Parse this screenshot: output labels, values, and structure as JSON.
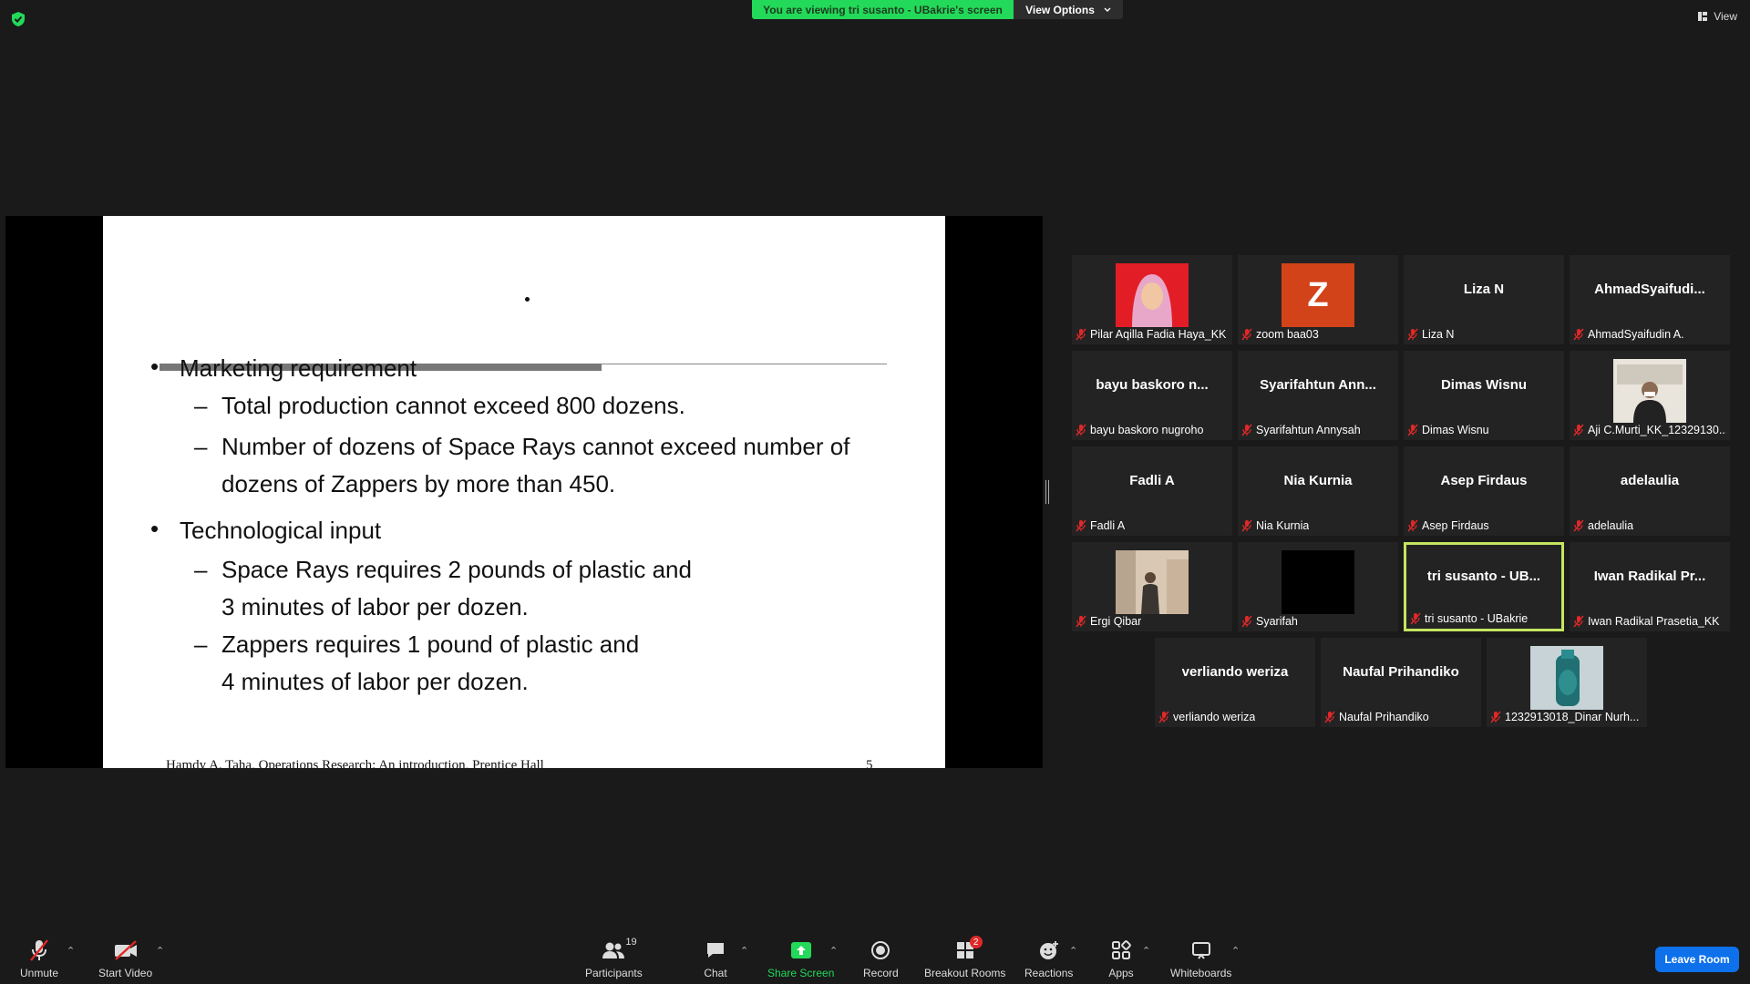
{
  "banner": {
    "viewing_text": "You are viewing tri susanto - UBakrie's screen",
    "view_options_label": "View Options"
  },
  "top_right": {
    "view_label": "View"
  },
  "slide": {
    "bullet1": "Marketing requirement",
    "sub1": "Total production cannot exceed 800 dozens.",
    "sub2_line1": "Number of dozens of Space Rays cannot exceed  number of",
    "sub2_line2": "dozens of Zappers by more than 450.",
    "bullet2": "Technological input",
    "sub3_line1": "Space Rays requires 2 pounds of plastic and",
    "sub3_line2": "3 minutes of labor per dozen.",
    "sub4_line1": " Zappers requires 1 pound of plastic and",
    "sub4_line2": "4 minutes of labor per dozen.",
    "footer_text": "Hamdy A. Taha, Operations Research: An introduction, Prentice Hall",
    "page_number": "5",
    "bullet_char": "•",
    "dash_char": "–"
  },
  "participants": [
    {
      "display": "",
      "label": "Pilar Aqilla Fadia Haya_KK",
      "avatar": "photo-hijab"
    },
    {
      "display": "Z",
      "label": "zoom baa03",
      "avatar": "letter"
    },
    {
      "display": "Liza N",
      "label": "Liza N",
      "avatar": "none"
    },
    {
      "display": "AhmadSyaifudi...",
      "label": "AhmadSyaifudin A.",
      "avatar": "none"
    },
    {
      "display": "bayu  baskoro  n...",
      "label": "bayu baskoro nugroho",
      "avatar": "none"
    },
    {
      "display": "Syarifahtun  Ann...",
      "label": "Syarifahtun Annysah",
      "avatar": "none"
    },
    {
      "display": "Dimas Wisnu",
      "label": "Dimas Wisnu",
      "avatar": "none"
    },
    {
      "display": "",
      "label": "Aji C.Murti_KK_12329130...",
      "avatar": "photo-man"
    },
    {
      "display": "Fadli A",
      "label": "Fadli A",
      "avatar": "none"
    },
    {
      "display": "Nia Kurnia",
      "label": "Nia Kurnia",
      "avatar": "none"
    },
    {
      "display": "Asep Firdaus",
      "label": "Asep Firdaus",
      "avatar": "none"
    },
    {
      "display": "adelaulia",
      "label": "adelaulia",
      "avatar": "none"
    },
    {
      "display": "",
      "label": "Ergi Qibar",
      "avatar": "photo-room"
    },
    {
      "display": "",
      "label": "Syarifah",
      "avatar": "black"
    },
    {
      "display": "tri  susanto  -  UB...",
      "label": "tri susanto - UBakrie",
      "avatar": "none"
    },
    {
      "display": "Iwan  Radikal  Pr...",
      "label": "Iwan Radikal Prasetia_KK",
      "avatar": "none"
    },
    {
      "display": "verliando weriza",
      "label": "verliando weriza",
      "avatar": "none"
    },
    {
      "display": "Naufal Prihandiko",
      "label": "Naufal Prihandiko",
      "avatar": "none"
    },
    {
      "display": "",
      "label": "1232913018_Dinar Nurh...",
      "avatar": "photo-bottle"
    }
  ],
  "toolbar": {
    "unmute": "Unmute",
    "start_video": "Start Video",
    "participants": "Participants",
    "participants_count": "19",
    "chat": "Chat",
    "share_screen": "Share Screen",
    "record": "Record",
    "breakout_rooms": "Breakout Rooms",
    "breakout_badge": "2",
    "reactions": "Reactions",
    "apps": "Apps",
    "whiteboards": "Whiteboards",
    "leave_room": "Leave Room"
  },
  "colors": {
    "share_green": "#23d959",
    "active_speaker": "#c3e55f",
    "leave_blue": "#0e71eb",
    "mic_red": "#e02828"
  }
}
